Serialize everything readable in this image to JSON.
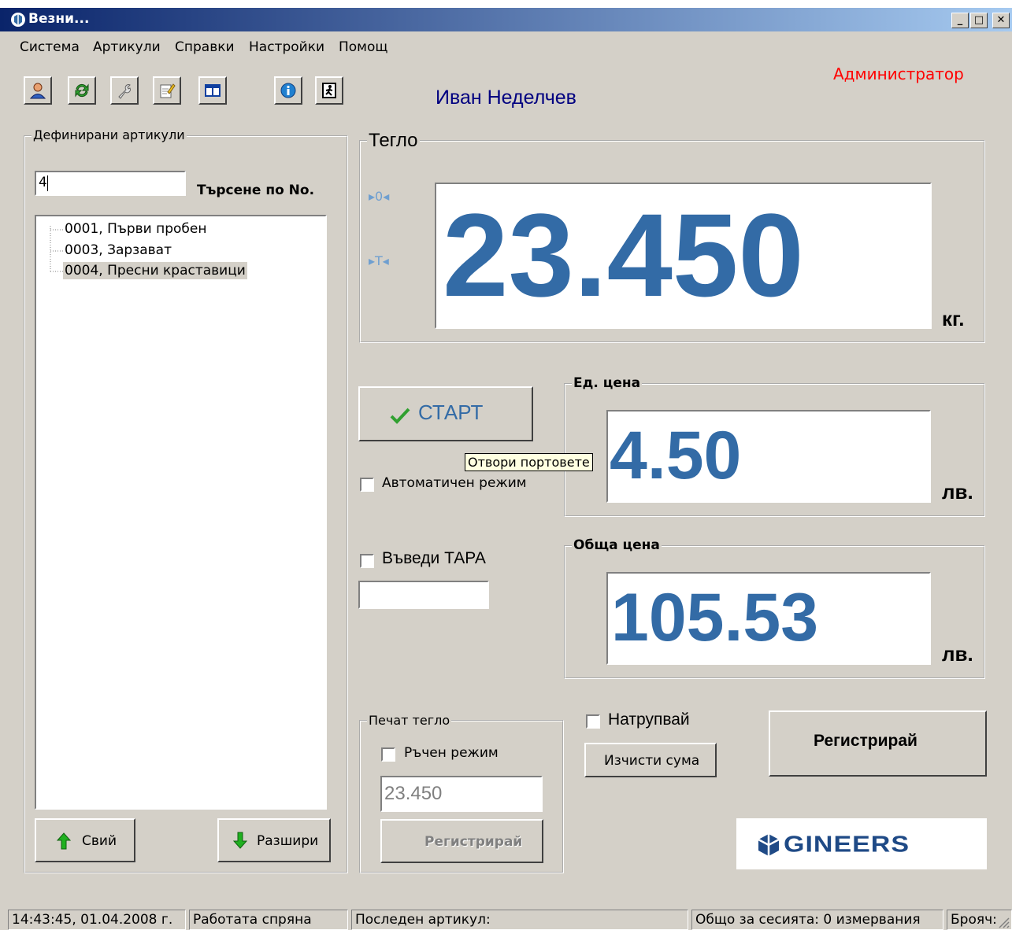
{
  "window": {
    "title": "Везни..."
  },
  "menu": [
    "Система",
    "Артикули",
    "Справки",
    "Настройки",
    "Помощ"
  ],
  "user": {
    "role": "Администратор",
    "name": "Иван Неделчев"
  },
  "articles": {
    "legend": "Дефинирани артикули",
    "search_value": "4",
    "search_label": "Търсене по No.",
    "items": [
      "0001, Първи пробен",
      "0003, Зарзават",
      "0004, Пресни краставици"
    ],
    "selected": "0004, Пресни краставици",
    "collapse_label": "Свий",
    "expand_label": "Разшири"
  },
  "weight": {
    "legend": "Тегло",
    "value": "23.450",
    "unit": "кг.",
    "zero_indicator": "▸0◂",
    "tare_indicator": "▸T◂"
  },
  "start_button": "СТАРТ",
  "tooltip": "Отвори портовете",
  "auto_mode_label": "Автоматичен режим",
  "unit_price": {
    "legend": "Ед. цена",
    "value": "4.50",
    "unit": "лв."
  },
  "tare": {
    "label": "Въведи ТАРА",
    "value": ""
  },
  "total_price": {
    "legend": "Обща цена",
    "value": "105.53",
    "unit": "лв."
  },
  "print_weight": {
    "legend": "Печат тегло",
    "manual_label": "Ръчен режим",
    "value": "23.450",
    "register_label": "Регистрирай"
  },
  "accumulate_label": "Натрупвай",
  "clear_sum_label": "Изчисти сума",
  "register_label": "Регистрирай",
  "logo_text": "GINEERS",
  "status": {
    "datetime": "14:43:45, 01.04.2008 г.",
    "state": "Работата спряна",
    "last_article": "Последен артикул:",
    "session": "Общо за сесията: 0 измервания",
    "counter": "Брояч:"
  },
  "colors": {
    "display_digits": "#336ba6",
    "role": "#ff0000",
    "user_name": "#000080",
    "titlebar_start": "#0a246a",
    "titlebar_end": "#a6caf0"
  }
}
